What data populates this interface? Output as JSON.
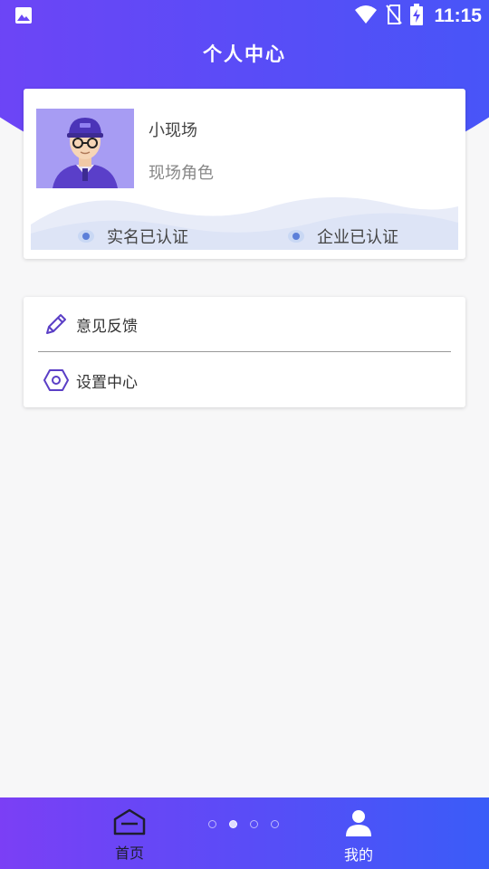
{
  "status_bar": {
    "time": "11:15",
    "icons": [
      "image-icon",
      "wifi-icon",
      "no-sim-icon",
      "battery-charging-icon"
    ]
  },
  "header": {
    "title": "个人中心",
    "gradient_colors": [
      "#7b3ff5",
      "#3a5cf8"
    ]
  },
  "profile": {
    "name": "小现场",
    "role": "现场角色",
    "avatar_icon": "worker-avatar",
    "badges": [
      {
        "label": "实名已认证",
        "icon": "verified-dot-icon"
      },
      {
        "label": "企业已认证",
        "icon": "verified-dot-icon"
      }
    ]
  },
  "menu": {
    "items": [
      {
        "label": "意见反馈",
        "icon": "pencil-icon"
      },
      {
        "label": "设置中心",
        "icon": "settings-hexagon-icon"
      }
    ]
  },
  "tab_bar": {
    "tabs": [
      {
        "label": "首页",
        "icon": "home-icon",
        "active": false
      },
      {
        "label": "我的",
        "icon": "user-icon",
        "active": true
      }
    ],
    "pager_active_index": 1,
    "pager_count": 4
  }
}
